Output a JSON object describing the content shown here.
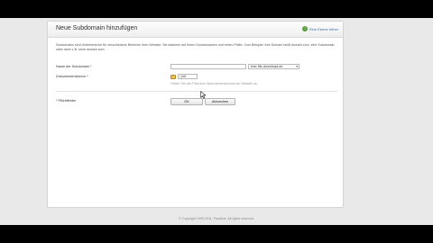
{
  "panel": {
    "title": "Neue Subdomain hinzufügen",
    "up_link": "Eine Ebene höher"
  },
  "intro": "Subdomains sind Unterbereiche für verschiedene Bereiche Ihrer Website. Sie basieren auf Ihrem Domainnamen und einem Präfix. Zum Beispiel: Ihre Domain heißt domain.com, eine Subdomain wäre dann z.B. store.domain.com.",
  "form": {
    "subdomain_label": "Name der Subdomain *",
    "subdomain_value": "",
    "domain_value": "free-file-download.de",
    "docroot_label": "Dokumentenstamm *",
    "docroot_value": "/ (httpdocs)",
    "docroot_short": "/ (htt",
    "docroot_hint": "Geben Sie den Pfad zum Speicherverzeichnis der Website an.",
    "required_note": "* Pflichtfelder",
    "ok_label": "OK",
    "cancel_label": "Abbrechen"
  },
  "footer": {
    "copyright": "© Copyright 1999-2011. Parallels. All rights reserved."
  },
  "icons": {
    "up": "arrow-up-icon",
    "folder": "folder-icon",
    "cursor": "mouse-cursor-icon"
  }
}
